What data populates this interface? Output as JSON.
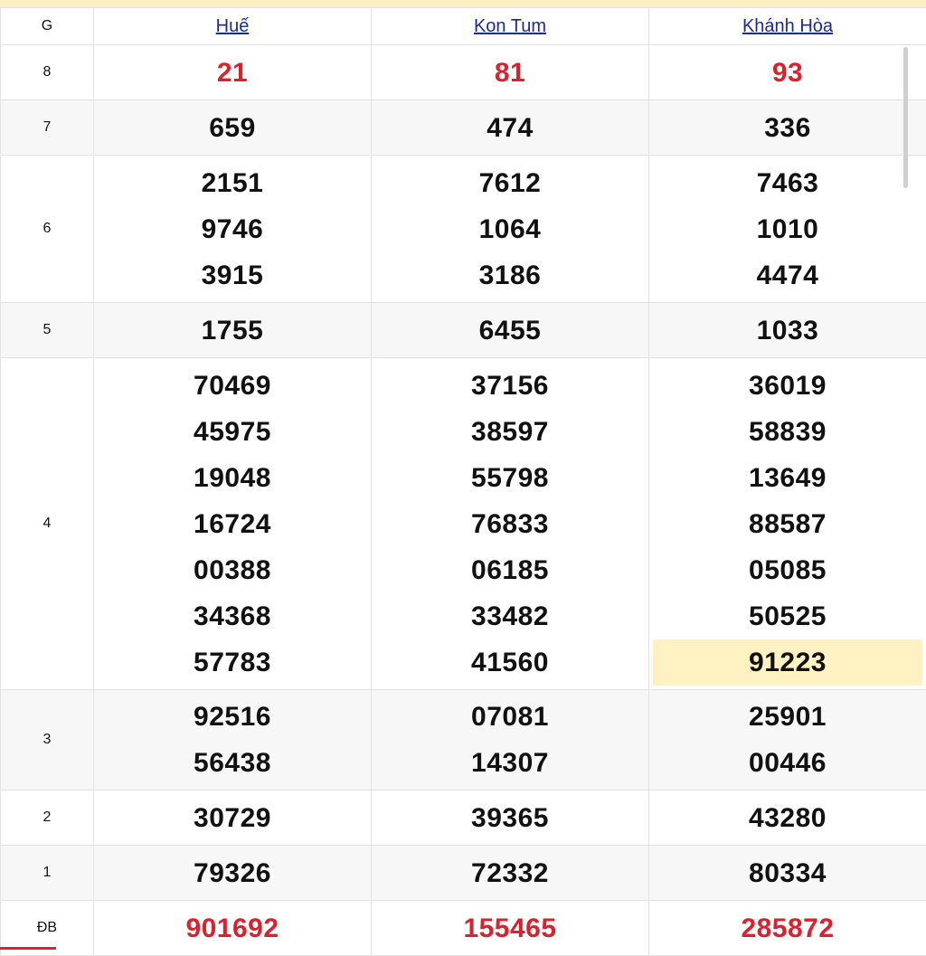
{
  "header": {
    "g_label": "G",
    "provinces": [
      "Huế",
      "Kon Tum",
      "Khánh Hòa"
    ]
  },
  "rows": [
    {
      "grade": "8",
      "huế": [
        "21"
      ],
      "kon_tum": [
        "81"
      ],
      "khanh_hoa": [
        "93"
      ]
    },
    {
      "grade": "7",
      "huế": [
        "659"
      ],
      "kon_tum": [
        "474"
      ],
      "khanh_hoa": [
        "336"
      ]
    },
    {
      "grade": "6",
      "huế": [
        "2151",
        "9746",
        "3915"
      ],
      "kon_tum": [
        "7612",
        "1064",
        "3186"
      ],
      "khanh_hoa": [
        "7463",
        "1010",
        "4474"
      ]
    },
    {
      "grade": "5",
      "huế": [
        "1755"
      ],
      "kon_tum": [
        "6455"
      ],
      "khanh_hoa": [
        "1033"
      ]
    },
    {
      "grade": "4",
      "huế": [
        "70469",
        "45975",
        "19048",
        "16724",
        "00388",
        "34368",
        "57783"
      ],
      "kon_tum": [
        "37156",
        "38597",
        "55798",
        "76833",
        "06185",
        "33482",
        "41560"
      ],
      "khanh_hoa": [
        "36019",
        "58839",
        "13649",
        "88587",
        "05085",
        "50525",
        "91223"
      ]
    },
    {
      "grade": "3",
      "huế": [
        "92516",
        "56438"
      ],
      "kon_tum": [
        "07081",
        "14307"
      ],
      "khanh_hoa": [
        "25901",
        "00446"
      ]
    },
    {
      "grade": "2",
      "huế": [
        "30729"
      ],
      "kon_tum": [
        "39365"
      ],
      "khanh_hoa": [
        "43280"
      ]
    },
    {
      "grade": "1",
      "huế": [
        "79326"
      ],
      "kon_tum": [
        "72332"
      ],
      "khanh_hoa": [
        "80334"
      ]
    },
    {
      "grade": "ĐB",
      "huế": [
        "901692"
      ],
      "kon_tum": [
        "155465"
      ],
      "khanh_hoa": [
        "285872"
      ]
    }
  ],
  "highlighted": {
    "row": "4",
    "column": "khanh_hoa",
    "value": "91223"
  },
  "colors": {
    "accent_red": "#d8232e",
    "link_blue": "#1a2b97",
    "highlight": "#fff2c2",
    "top_band": "#fcefc2"
  }
}
